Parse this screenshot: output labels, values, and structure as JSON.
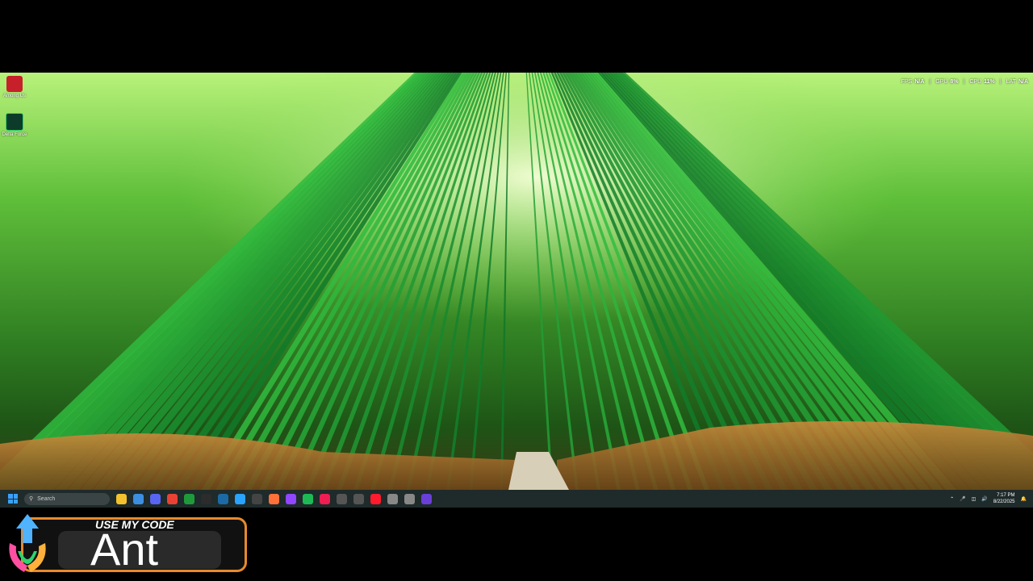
{
  "desktop_icons": [
    {
      "label": "Among Us",
      "icon": "among-us-icon",
      "color": "#c8202a"
    },
    {
      "label": "Delta Force",
      "icon": "delta-force-icon",
      "color": "#2bd46a"
    }
  ],
  "perf_overlay": {
    "fps_label": "FPS",
    "fps_value": "N/A",
    "gpu_label": "GPU",
    "gpu_value": "8%",
    "cpu_label": "CPU",
    "cpu_value": "11%",
    "lat_label": "LAT",
    "lat_value": "N/A"
  },
  "taskbar": {
    "search_placeholder": "Search",
    "apps": [
      {
        "icon": "file-explorer-icon",
        "color": "#f2c12e"
      },
      {
        "icon": "gallery-icon",
        "color": "#3b8ee0"
      },
      {
        "icon": "discord-icon",
        "color": "#5865f2"
      },
      {
        "icon": "chrome-icon",
        "color": "#e94235"
      },
      {
        "icon": "xbox-icon",
        "color": "#1f9a3a"
      },
      {
        "icon": "epic-games-icon",
        "color": "#2c2c2c"
      },
      {
        "icon": "steam-icon",
        "color": "#1b6aa5"
      },
      {
        "icon": "media-player-icon",
        "color": "#2aa2ff"
      },
      {
        "icon": "obs-icon",
        "color": "#444"
      },
      {
        "icon": "firefox-icon",
        "color": "#ff7139"
      },
      {
        "icon": "twitch-icon",
        "color": "#9146ff"
      },
      {
        "icon": "spotify-icon",
        "color": "#1db954"
      },
      {
        "icon": "tiktok-icon",
        "color": "#ee1d52"
      },
      {
        "icon": "reddit-icon",
        "color": "#555"
      },
      {
        "icon": "controller-icon",
        "color": "#555"
      },
      {
        "icon": "opera-icon",
        "color": "#ff1b2d"
      },
      {
        "icon": "settings-icon",
        "color": "#888"
      },
      {
        "icon": "steelseries-icon",
        "color": "#888"
      },
      {
        "icon": "streamlabs-icon",
        "color": "#6a3fd8"
      }
    ],
    "tray": {
      "time": "7:17 PM",
      "date": "8/22/2025"
    }
  },
  "promo": {
    "headline": "USE MY CODE",
    "code": "Ant",
    "accent_color": "#e88a2a"
  }
}
